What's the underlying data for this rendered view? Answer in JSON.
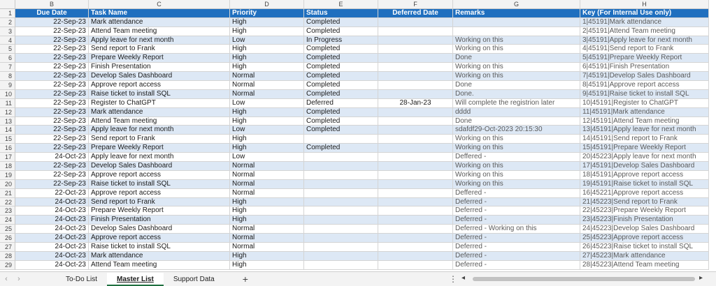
{
  "column_letters": [
    "B",
    "C",
    "D",
    "E",
    "F",
    "G",
    "H"
  ],
  "header_row": {
    "row_number": "1",
    "due_date": "Due Date",
    "task_name": "Task Name",
    "priority": "Priority",
    "status": "Status",
    "deferred_date": "Deferred Date",
    "remarks": "Remarks",
    "key": "Key (For Internal Use only)"
  },
  "rows": [
    {
      "n": "2",
      "due": "22-Sep-23",
      "task": "Mark attendance",
      "priority": "High",
      "status": "Completed",
      "deferred": "",
      "remarks": "",
      "key": "1|45191|Mark attendance"
    },
    {
      "n": "3",
      "due": "22-Sep-23",
      "task": "Attend Team meeting",
      "priority": "High",
      "status": "Completed",
      "deferred": "",
      "remarks": "",
      "key": "2|45191|Attend Team meeting"
    },
    {
      "n": "4",
      "due": "22-Sep-23",
      "task": "Apply leave for next month",
      "priority": "Low",
      "status": "In Progress",
      "deferred": "",
      "remarks": "Working on this",
      "key": "3|45191|Apply leave for next month"
    },
    {
      "n": "5",
      "due": "22-Sep-23",
      "task": "Send report to Frank",
      "priority": "High",
      "status": "Completed",
      "deferred": "",
      "remarks": "Working on this",
      "key": "4|45191|Send report to Frank"
    },
    {
      "n": "6",
      "due": "22-Sep-23",
      "task": "Prepare Weekly Report",
      "priority": "High",
      "status": "Completed",
      "deferred": "",
      "remarks": "Done",
      "key": "5|45191|Prepare Weekly Report"
    },
    {
      "n": "7",
      "due": "22-Sep-23",
      "task": "Finish Presentation",
      "priority": "High",
      "status": "Completed",
      "deferred": "",
      "remarks": "Working on this",
      "key": "6|45191|Finish Presentation"
    },
    {
      "n": "8",
      "due": "22-Sep-23",
      "task": "Develop Sales Dashboard",
      "priority": "Normal",
      "status": "Completed",
      "deferred": "",
      "remarks": "Working on this",
      "key": "7|45191|Develop Sales Dashboard"
    },
    {
      "n": "9",
      "due": "22-Sep-23",
      "task": "Approve report access",
      "priority": "Normal",
      "status": "Completed",
      "deferred": "",
      "remarks": "Done",
      "key": "8|45191|Approve report access"
    },
    {
      "n": "10",
      "due": "22-Sep-23",
      "task": "Raise ticket to install SQL",
      "priority": "Normal",
      "status": "Completed",
      "deferred": "",
      "remarks": "Done.",
      "key": "9|45191|Raise ticket to install SQL"
    },
    {
      "n": "11",
      "due": "22-Sep-23",
      "task": "Register to ChatGPT",
      "priority": "Low",
      "status": "Deferred",
      "deferred": "28-Jan-23",
      "remarks": "Will complete the registrion later",
      "key": "10|45191|Register to ChatGPT"
    },
    {
      "n": "12",
      "due": "22-Sep-23",
      "task": "Mark attendance",
      "priority": "High",
      "status": "Completed",
      "deferred": "",
      "remarks": "dddd",
      "key": "11|45191|Mark attendance"
    },
    {
      "n": "13",
      "due": "22-Sep-23",
      "task": "Attend Team meeting",
      "priority": "High",
      "status": "Completed",
      "deferred": "",
      "remarks": "Done",
      "key": "12|45191|Attend Team meeting"
    },
    {
      "n": "14",
      "due": "22-Sep-23",
      "task": "Apply leave for next month",
      "priority": "Low",
      "status": "Completed",
      "deferred": "",
      "remarks": "sdafdf29-Oct-2023 20:15:30",
      "key": "13|45191|Apply leave for next month"
    },
    {
      "n": "15",
      "due": "22-Sep-23",
      "task": "Send report to Frank",
      "priority": "High",
      "status": "",
      "deferred": "",
      "remarks": "Working on this",
      "key": "14|45191|Send report to Frank"
    },
    {
      "n": "16",
      "due": "22-Sep-23",
      "task": "Prepare Weekly Report",
      "priority": "High",
      "status": "Completed",
      "deferred": "",
      "remarks": "Working on this",
      "key": "15|45191|Prepare Weekly Report"
    },
    {
      "n": "17",
      "due": "24-Oct-23",
      "task": "Apply leave for next month",
      "priority": "Low",
      "status": "",
      "deferred": "",
      "remarks": "Deffered -",
      "key": "20|45223|Apply leave for next month"
    },
    {
      "n": "18",
      "due": "22-Sep-23",
      "task": "Develop Sales Dashboard",
      "priority": "Normal",
      "status": "",
      "deferred": "",
      "remarks": "Working on this",
      "key": "17|45191|Develop Sales Dashboard"
    },
    {
      "n": "19",
      "due": "22-Sep-23",
      "task": "Approve report access",
      "priority": "Normal",
      "status": "",
      "deferred": "",
      "remarks": "Working on this",
      "key": "18|45191|Approve report access"
    },
    {
      "n": "20",
      "due": "22-Sep-23",
      "task": "Raise ticket to install SQL",
      "priority": "Normal",
      "status": "",
      "deferred": "",
      "remarks": "Working on this",
      "key": "19|45191|Raise ticket to install SQL"
    },
    {
      "n": "21",
      "due": "22-Oct-23",
      "task": "Approve report access",
      "priority": "Normal",
      "status": "",
      "deferred": "",
      "remarks": "Deffered -",
      "key": "16|45221|Approve report access"
    },
    {
      "n": "22",
      "due": "24-Oct-23",
      "task": "Send report to Frank",
      "priority": "High",
      "status": "",
      "deferred": "",
      "remarks": "Deferred -",
      "key": "21|45223|Send report to Frank"
    },
    {
      "n": "23",
      "due": "24-Oct-23",
      "task": "Prepare Weekly Report",
      "priority": "High",
      "status": "",
      "deferred": "",
      "remarks": "Deferred -",
      "key": "22|45223|Prepare Weekly Report"
    },
    {
      "n": "24",
      "due": "24-Oct-23",
      "task": "Finish Presentation",
      "priority": "High",
      "status": "",
      "deferred": "",
      "remarks": "Deferred -",
      "key": "23|45223|Finish Presentation"
    },
    {
      "n": "25",
      "due": "24-Oct-23",
      "task": "Develop Sales Dashboard",
      "priority": "Normal",
      "status": "",
      "deferred": "",
      "remarks": "Deferred - Working on this",
      "key": "24|45223|Develop Sales Dashboard"
    },
    {
      "n": "26",
      "due": "24-Oct-23",
      "task": "Approve report access",
      "priority": "Normal",
      "status": "",
      "deferred": "",
      "remarks": "Deferred -",
      "key": "25|45223|Approve report access"
    },
    {
      "n": "27",
      "due": "24-Oct-23",
      "task": "Raise ticket to install SQL",
      "priority": "Normal",
      "status": "",
      "deferred": "",
      "remarks": "Deferred -",
      "key": "26|45223|Raise ticket to install SQL"
    },
    {
      "n": "28",
      "due": "24-Oct-23",
      "task": "Mark attendance",
      "priority": "High",
      "status": "",
      "deferred": "",
      "remarks": "Deferred -",
      "key": "27|45223|Mark attendance"
    },
    {
      "n": "29",
      "due": "24-Oct-23",
      "task": "Attend Team meeting",
      "priority": "High",
      "status": "",
      "deferred": "",
      "remarks": "Deferred -",
      "key": "28|45223|Attend Team meeting"
    }
  ],
  "sheet_tabs": {
    "prev_icon": "chevron-left-icon",
    "next_icon": "chevron-right-icon",
    "tabs": [
      {
        "label": "To-Do List",
        "active": false
      },
      {
        "label": "Master List",
        "active": true
      },
      {
        "label": "Support Data",
        "active": false
      }
    ],
    "add_label": "+"
  },
  "colors": {
    "header_bg": "#1f6fbf",
    "band_bg": "#dde8f5",
    "active_tab_underline": "#1f6f3f"
  }
}
